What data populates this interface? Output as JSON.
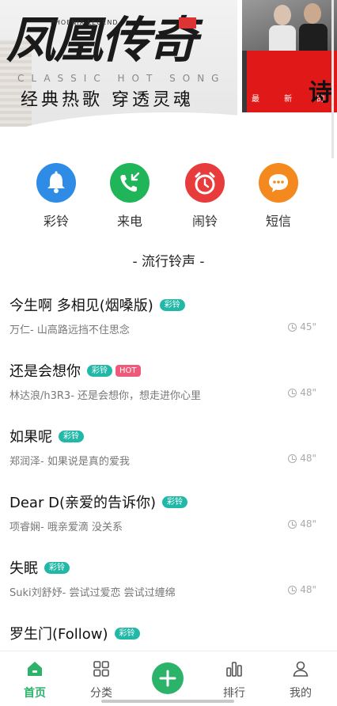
{
  "banner": {
    "title": "凤凰传奇",
    "small_en": "PHOENIX LEGEND",
    "subtitle_en": "CLASSIC HOT SONG",
    "subtitle": "经典热歌 穿透灵魂",
    "right_text": "最 新 的",
    "right_big": "诗"
  },
  "shortcuts": [
    {
      "label": "彩铃",
      "icon": "bell-icon",
      "color": "#2e8be6"
    },
    {
      "label": "来电",
      "icon": "incoming-call-icon",
      "color": "#1fb558"
    },
    {
      "label": "闹铃",
      "icon": "alarm-clock-icon",
      "color": "#e83c3c"
    },
    {
      "label": "短信",
      "icon": "message-icon",
      "color": "#f48a1f"
    }
  ],
  "section_title": "- 流行铃声 -",
  "songs": [
    {
      "name": "今生啊 多相见(烟嗓版)",
      "badge": "彩铃",
      "hot": "",
      "desc": "万仁- 山高路远挡不住思念",
      "duration": "45\""
    },
    {
      "name": "还是会想你",
      "badge": "彩铃",
      "hot": "HOT",
      "desc": "林达浪/h3R3- 还是会想你，想走进你心里",
      "duration": "48\""
    },
    {
      "name": "如果呢",
      "badge": "彩铃",
      "hot": "",
      "desc": "郑润泽- 如果说是真的爱我",
      "duration": "48\""
    },
    {
      "name": "Dear D(亲爱的告诉你)",
      "badge": "彩铃",
      "hot": "",
      "desc": "项睿娴- 哦亲爱滴 没关系",
      "duration": "48\""
    },
    {
      "name": "失眠",
      "badge": "彩铃",
      "hot": "",
      "desc": "Suki刘舒妤- 尝试过爱恋 尝试过缠绵",
      "duration": "48\""
    },
    {
      "name": "罗生门(Follow)",
      "badge": "彩铃",
      "hot": "",
      "desc": "",
      "duration": ""
    }
  ],
  "nav": {
    "home": "首页",
    "category": "分类",
    "rank": "排行",
    "mine": "我的"
  },
  "colors": {
    "accent": "#2bb36a",
    "badge": "#22b8a7",
    "hot": "#ef5a7a"
  }
}
